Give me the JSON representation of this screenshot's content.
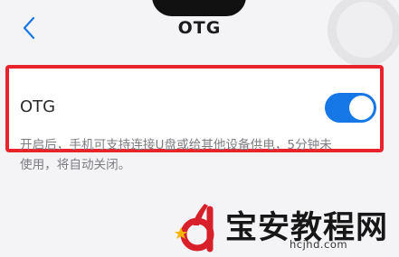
{
  "header": {
    "title": "OTG",
    "back_icon": "chevron-left-icon"
  },
  "otg_row": {
    "label": "OTG",
    "toggle_on": true
  },
  "description": {
    "line1": "开启后，手机可支持连接U盘或给其他设备供电，5分钟未",
    "line2": "使用，将自动关闭。"
  },
  "watermark": {
    "name": "宝安教程网",
    "url": "hcjhd.com"
  },
  "colors": {
    "accent": "#1677e6",
    "highlight_border": "#e8232b",
    "background": "#f4f4f6"
  }
}
